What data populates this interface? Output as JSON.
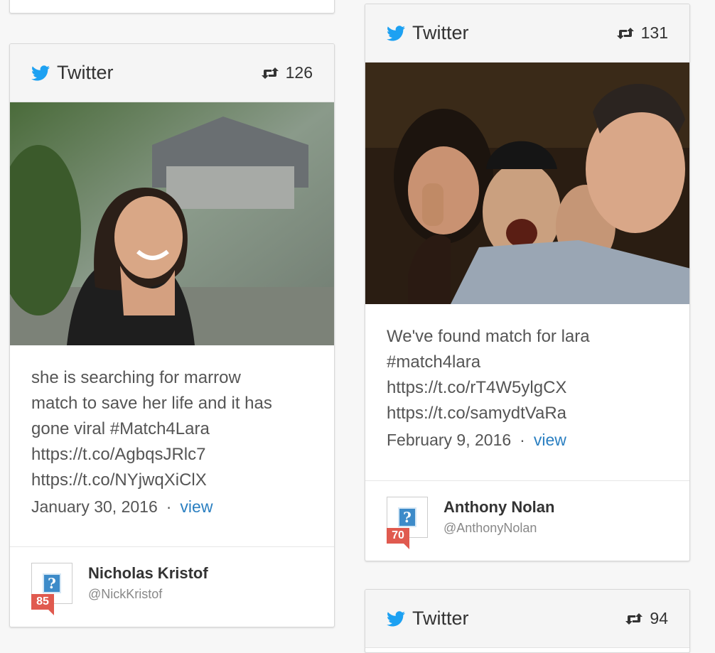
{
  "colors": {
    "twitter_blue": "#1da1f2",
    "link_blue": "#2a7fc1",
    "score_red": "#e05a4f"
  },
  "cards": [
    {
      "brand": "Twitter",
      "retweet_count": "126",
      "text": "she is searching for marrow\nmatch to save her life and it has\ngone viral #Match4Lara\nhttps://t.co/AgbqsJRlc7\nhttps://t.co/NYjwqXiClX",
      "date": "January 30, 2016",
      "separator": "·",
      "view_label": "view",
      "author_name": "Nicholas Kristof",
      "author_handle": "@NickKristof",
      "score": "85"
    },
    {
      "brand": "Twitter",
      "retweet_count": "131",
      "text": "We've found match for lara\n#match4lara\nhttps://t.co/rT4W5ylgCX\nhttps://t.co/samydtVaRa",
      "date": "February 9, 2016",
      "separator": "·",
      "view_label": "view",
      "author_name": "Anthony Nolan",
      "author_handle": "@AnthonyNolan",
      "score": "70"
    },
    {
      "brand": "Twitter",
      "retweet_count": "94"
    }
  ]
}
